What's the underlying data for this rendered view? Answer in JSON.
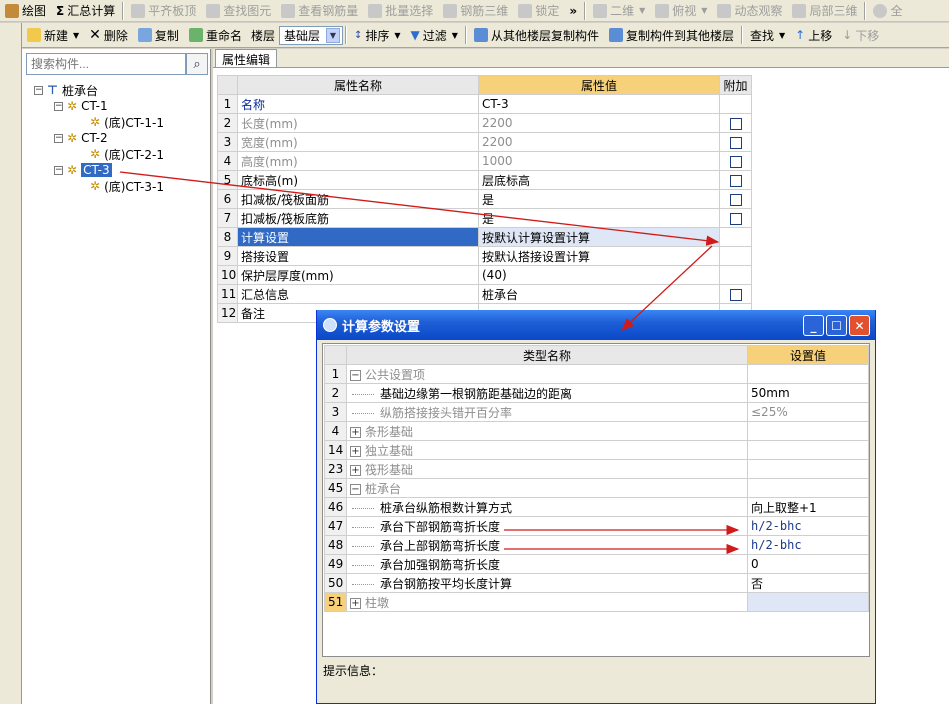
{
  "toolbar1": {
    "items": [
      "绘图",
      "汇总计算",
      "平齐板顶",
      "查找图元",
      "查看钢筋量",
      "批量选择",
      "钢筋三维",
      "锁定",
      "二维",
      "俯视",
      "动态观察",
      "局部三维",
      "全"
    ],
    "more": "»"
  },
  "toolbar2": {
    "new": "新建",
    "delete": "删除",
    "copy": "复制",
    "rename": "重命名",
    "floor_label": "楼层",
    "floor_value": "基础层",
    "sort": "排序",
    "filter": "过滤",
    "copy_from": "从其他楼层复制构件",
    "copy_to": "复制构件到其他楼层",
    "find": "查找",
    "up": "上移",
    "down": "下移"
  },
  "search": {
    "placeholder": "搜索构件..."
  },
  "tree": {
    "root": "桩承台",
    "nodes": [
      {
        "label": "CT-1",
        "child": "(底)CT-1-1"
      },
      {
        "label": "CT-2",
        "child": "(底)CT-2-1"
      },
      {
        "label": "CT-3",
        "child": "(底)CT-3-1"
      }
    ]
  },
  "props": {
    "tab": "属性编辑",
    "headers": [
      "属性名称",
      "属性值",
      "附加"
    ],
    "rows": [
      {
        "n": "1",
        "name": "名称",
        "value": "CT-3"
      },
      {
        "n": "2",
        "name": "长度(mm)",
        "value": "2200"
      },
      {
        "n": "3",
        "name": "宽度(mm)",
        "value": "2200"
      },
      {
        "n": "4",
        "name": "高度(mm)",
        "value": "1000"
      },
      {
        "n": "5",
        "name": "底标高(m)",
        "value": "层底标高"
      },
      {
        "n": "6",
        "name": "扣减板/筏板面筋",
        "value": "是"
      },
      {
        "n": "7",
        "name": "扣减板/筏板底筋",
        "value": "是"
      },
      {
        "n": "8",
        "name": "计算设置",
        "value": "按默认计算设置计算"
      },
      {
        "n": "9",
        "name": "搭接设置",
        "value": "按默认搭接设置计算"
      },
      {
        "n": "10",
        "name": "保护层厚度(mm)",
        "value": "(40)"
      },
      {
        "n": "11",
        "name": "汇总信息",
        "value": "桩承台"
      },
      {
        "n": "12",
        "name": "备注",
        "value": ""
      }
    ]
  },
  "dialog": {
    "title": "计算参数设置",
    "headers": [
      "类型名称",
      "设置值"
    ],
    "rows": [
      {
        "n": "1",
        "name": "公共设置项",
        "value": "",
        "box": "−"
      },
      {
        "n": "2",
        "name": "基础边缘第一根钢筋距基础边的距离",
        "value": "50mm"
      },
      {
        "n": "3",
        "name": "纵筋搭接接头错开百分率",
        "value": "≤25%"
      },
      {
        "n": "4",
        "name": "条形基础",
        "value": "",
        "box": "+"
      },
      {
        "n": "14",
        "name": "独立基础",
        "value": "",
        "box": "+"
      },
      {
        "n": "23",
        "name": "筏形基础",
        "value": "",
        "box": "+"
      },
      {
        "n": "45",
        "name": "桩承台",
        "value": "",
        "box": "−"
      },
      {
        "n": "46",
        "name": "桩承台纵筋根数计算方式",
        "value": "向上取整+1"
      },
      {
        "n": "47",
        "name": "承台下部钢筋弯折长度",
        "value": "h/2-bhc"
      },
      {
        "n": "48",
        "name": "承台上部钢筋弯折长度",
        "value": "h/2-bhc"
      },
      {
        "n": "49",
        "name": "承台加强钢筋弯折长度",
        "value": "0"
      },
      {
        "n": "50",
        "name": "承台钢筋按平均长度计算",
        "value": "否"
      },
      {
        "n": "51",
        "name": "柱墩",
        "value": "",
        "box": "+"
      }
    ],
    "hint_label": "提示信息："
  },
  "colors": {
    "accent": "#316ac5",
    "header_value": "#f7d17a",
    "arrow": "#d11a1a"
  }
}
